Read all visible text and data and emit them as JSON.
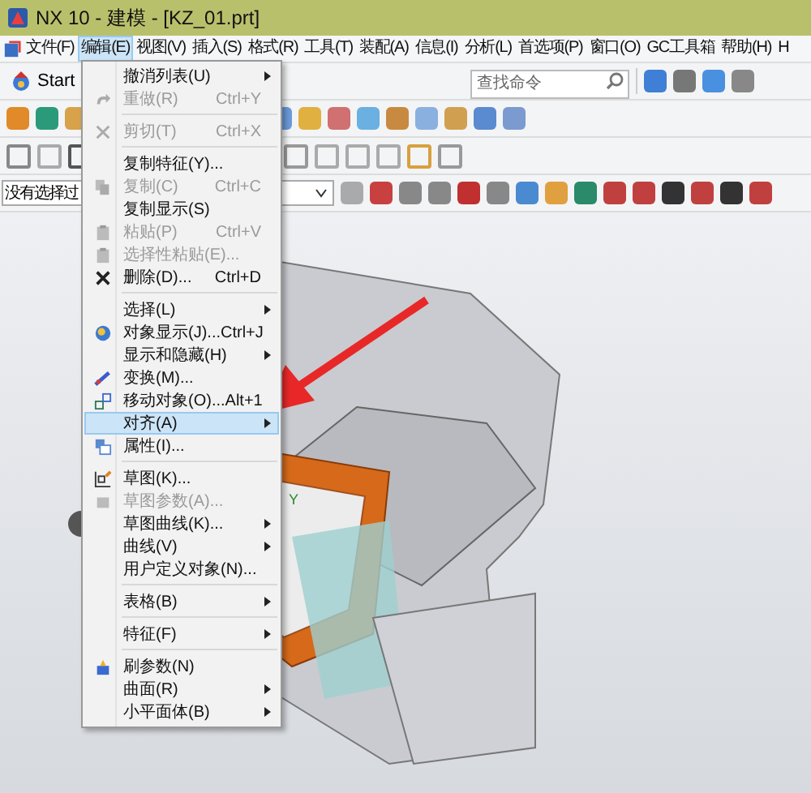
{
  "window": {
    "title": "NX 10 - 建模 - [KZ_01.prt]"
  },
  "menubar": [
    {
      "label": "文件(F)",
      "selected": false
    },
    {
      "label": "编辑(E)",
      "selected": true
    },
    {
      "label": "视图(V)",
      "selected": false
    },
    {
      "label": "插入(S)",
      "selected": false
    },
    {
      "label": "格式(R)",
      "selected": false
    },
    {
      "label": "工具(T)",
      "selected": false
    },
    {
      "label": "装配(A)",
      "selected": false
    },
    {
      "label": "信息(I)",
      "selected": false
    },
    {
      "label": "分析(L)",
      "selected": false
    },
    {
      "label": "首选项(P)",
      "selected": false
    },
    {
      "label": "窗口(O)",
      "selected": false
    },
    {
      "label": "GC工具箱",
      "selected": false
    },
    {
      "label": "帮助(H)",
      "selected": false
    },
    {
      "label": "H",
      "selected": false
    }
  ],
  "toolbar": {
    "start_label": "Start",
    "search": {
      "placeholder": "查找命令"
    },
    "filter": {
      "value": "没有选择过"
    }
  },
  "viewport": {
    "axis_label": "Y"
  },
  "edit_menu": [
    {
      "kind": "item",
      "label": "撤消列表(U)",
      "submenu": true,
      "disabled": false,
      "selected": false
    },
    {
      "kind": "item",
      "label": "重做(R)",
      "shortcut": "Ctrl+Y",
      "submenu": false,
      "disabled": true,
      "selected": false
    },
    {
      "kind": "separator"
    },
    {
      "kind": "item",
      "label": "剪切(T)",
      "shortcut": "Ctrl+X",
      "submenu": false,
      "disabled": true,
      "selected": false
    },
    {
      "kind": "separator"
    },
    {
      "kind": "item",
      "label": "复制特征(Y)...",
      "submenu": false,
      "disabled": false,
      "selected": false
    },
    {
      "kind": "item",
      "label": "复制(C)",
      "shortcut": "Ctrl+C",
      "submenu": false,
      "disabled": true,
      "selected": false
    },
    {
      "kind": "item",
      "label": "复制显示(S)",
      "submenu": false,
      "disabled": false,
      "selected": false
    },
    {
      "kind": "item",
      "label": "粘贴(P)",
      "shortcut": "Ctrl+V",
      "submenu": false,
      "disabled": true,
      "selected": false
    },
    {
      "kind": "item",
      "label": "选择性粘贴(E)...",
      "submenu": false,
      "disabled": true,
      "selected": false
    },
    {
      "kind": "item",
      "label": "删除(D)...",
      "shortcut": "Ctrl+D",
      "submenu": false,
      "disabled": false,
      "selected": false
    },
    {
      "kind": "separator"
    },
    {
      "kind": "item",
      "label": "选择(L)",
      "submenu": true,
      "disabled": false,
      "selected": false
    },
    {
      "kind": "item",
      "label": "对象显示(J)...",
      "shortcut": "Ctrl+J",
      "submenu": false,
      "disabled": false,
      "selected": false
    },
    {
      "kind": "item",
      "label": "显示和隐藏(H)",
      "submenu": true,
      "disabled": false,
      "selected": false
    },
    {
      "kind": "item",
      "label": "变换(M)...",
      "submenu": false,
      "disabled": false,
      "selected": false
    },
    {
      "kind": "item",
      "label": "移动对象(O)...",
      "shortcut": "Alt+1",
      "submenu": false,
      "disabled": false,
      "selected": false
    },
    {
      "kind": "item",
      "label": "对齐(A)",
      "submenu": true,
      "disabled": false,
      "selected": true
    },
    {
      "kind": "item",
      "label": "属性(I)...",
      "submenu": false,
      "disabled": false,
      "selected": false
    },
    {
      "kind": "separator"
    },
    {
      "kind": "item",
      "label": "草图(K)...",
      "submenu": false,
      "disabled": false,
      "selected": false
    },
    {
      "kind": "item",
      "label": "草图参数(A)...",
      "submenu": false,
      "disabled": true,
      "selected": false
    },
    {
      "kind": "item",
      "label": "草图曲线(K)...",
      "submenu": true,
      "disabled": false,
      "selected": false
    },
    {
      "kind": "item",
      "label": "曲线(V)",
      "submenu": true,
      "disabled": false,
      "selected": false
    },
    {
      "kind": "item",
      "label": "用户定义对象(N)...",
      "submenu": false,
      "disabled": false,
      "selected": false
    },
    {
      "kind": "separator"
    },
    {
      "kind": "item",
      "label": "表格(B)",
      "submenu": true,
      "disabled": false,
      "selected": false
    },
    {
      "kind": "separator"
    },
    {
      "kind": "item",
      "label": "特征(F)",
      "submenu": true,
      "disabled": false,
      "selected": false
    },
    {
      "kind": "separator"
    },
    {
      "kind": "item",
      "label": "刷参数(N)",
      "submenu": false,
      "disabled": false,
      "selected": false
    },
    {
      "kind": "item",
      "label": "曲面(R)",
      "submenu": true,
      "disabled": false,
      "selected": false
    },
    {
      "kind": "item",
      "label": "小平面体(B)",
      "submenu": true,
      "disabled": false,
      "selected": false
    }
  ]
}
